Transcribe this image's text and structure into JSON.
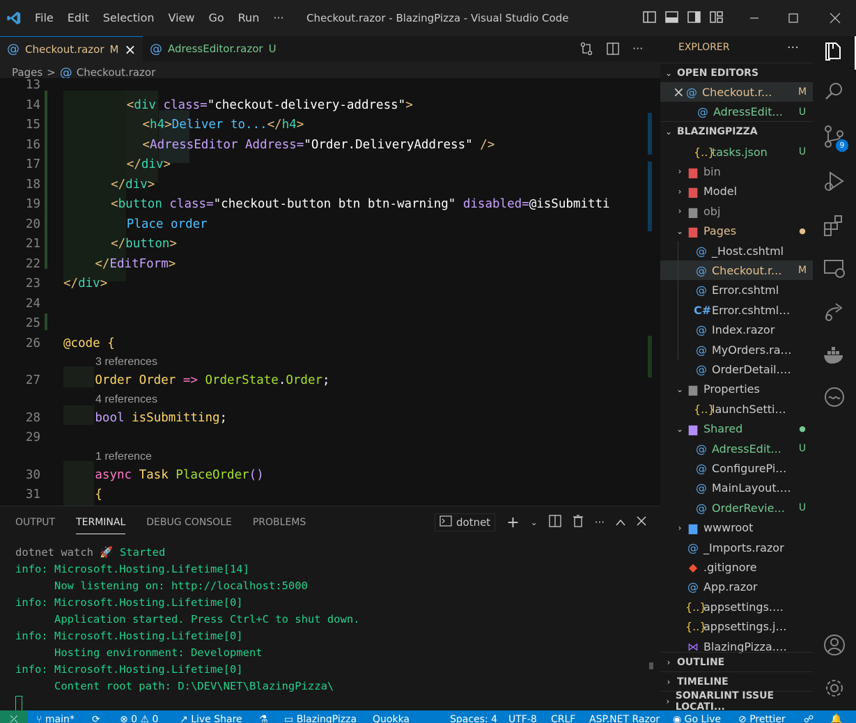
{
  "window": {
    "title": "Checkout.razor - BlazingPizza - Visual Studio Code"
  },
  "menu": [
    "File",
    "Edit",
    "Selection",
    "View",
    "Go",
    "Run",
    "···"
  ],
  "tabs": [
    {
      "label": "Checkout.razor",
      "status": "M",
      "close": "×"
    },
    {
      "label": "AdressEditor.razor",
      "status": "U"
    }
  ],
  "breadcrumb": {
    "folder": "Pages",
    "sep": ">",
    "file": "Checkout.razor"
  },
  "editor": {
    "lines": [
      {
        "n": "13"
      },
      {
        "n": "14",
        "indent": 4,
        "parts": [
          [
            "t-tag",
            "<"
          ],
          [
            "t-name",
            "div"
          ],
          [
            "t-attr",
            " class"
          ],
          [
            "t-punc",
            "="
          ],
          [
            "t-str",
            "\"checkout-delivery-address\""
          ],
          [
            "t-tag",
            ">"
          ]
        ]
      },
      {
        "n": "15",
        "indent": 5,
        "parts": [
          [
            "t-tag",
            "<"
          ],
          [
            "t-name",
            "h4"
          ],
          [
            "t-tag",
            ">"
          ],
          [
            "t-txt",
            "Deliver to..."
          ],
          [
            "t-tag",
            "</"
          ],
          [
            "t-name",
            "h4"
          ],
          [
            "t-tag",
            ">"
          ]
        ]
      },
      {
        "n": "16",
        "indent": 5,
        "parts": [
          [
            "t-tag",
            "<"
          ],
          [
            "t-attr",
            "AdressEditor"
          ],
          [
            "t-attr",
            " Address"
          ],
          [
            "t-punc",
            "="
          ],
          [
            "t-str",
            "\"Order.DeliveryAddress\""
          ],
          [
            "t-tag",
            " />"
          ]
        ]
      },
      {
        "n": "17",
        "indent": 4,
        "parts": [
          [
            "t-tag",
            "</"
          ],
          [
            "t-name",
            "div"
          ],
          [
            "t-tag",
            ">"
          ]
        ]
      },
      {
        "n": "18",
        "indent": 3,
        "parts": [
          [
            "t-tag",
            "</"
          ],
          [
            "t-name",
            "div"
          ],
          [
            "t-tag",
            ">"
          ]
        ]
      },
      {
        "n": "19",
        "indent": 3,
        "parts": [
          [
            "t-tag",
            "<"
          ],
          [
            "t-name",
            "button"
          ],
          [
            "t-attr",
            " class"
          ],
          [
            "t-punc",
            "="
          ],
          [
            "t-str",
            "\"checkout-button btn btn-warning\""
          ],
          [
            "t-attr",
            " disabled"
          ],
          [
            "t-punc",
            "="
          ],
          [
            "t-str",
            "@isSubmitti"
          ]
        ]
      },
      {
        "n": "20",
        "indent": 4,
        "parts": [
          [
            "t-txt",
            "Place order"
          ]
        ]
      },
      {
        "n": "21",
        "indent": 3,
        "parts": [
          [
            "t-tag",
            "</"
          ],
          [
            "t-name",
            "button"
          ],
          [
            "t-tag",
            ">"
          ]
        ]
      },
      {
        "n": "22",
        "indent": 2,
        "parts": [
          [
            "t-tag",
            "</"
          ],
          [
            "t-attr",
            "EditForm"
          ],
          [
            "t-tag",
            ">"
          ]
        ]
      },
      {
        "n": "23",
        "indent": 0,
        "parts": [
          [
            "t-tag",
            "</"
          ],
          [
            "t-name",
            "div"
          ],
          [
            "t-tag",
            ">"
          ]
        ]
      },
      {
        "n": "24"
      },
      {
        "n": "25"
      },
      {
        "n": "26",
        "indent": 0,
        "parts": [
          [
            "t-code",
            "@code"
          ],
          [
            "t-type",
            " {"
          ]
        ]
      },
      {
        "ref": "3 references"
      },
      {
        "n": "27",
        "indent": 2,
        "parts": [
          [
            "t-type",
            "Order"
          ],
          [
            "t-type",
            " Order"
          ],
          [
            "t-kw",
            " =>"
          ],
          [
            "t-fn",
            " OrderState"
          ],
          [
            "t-var",
            "."
          ],
          [
            "t-fn",
            "Order"
          ],
          [
            "t-var",
            ";"
          ]
        ]
      },
      {
        "ref": "4 references"
      },
      {
        "n": "28",
        "indent": 2,
        "parts": [
          [
            "t-attr",
            "bool"
          ],
          [
            "t-type",
            " isSubmitting"
          ],
          [
            "t-var",
            ";"
          ]
        ]
      },
      {
        "n": "29"
      },
      {
        "ref": "1 reference"
      },
      {
        "n": "30",
        "indent": 2,
        "parts": [
          [
            "t-kw",
            "async"
          ],
          [
            "t-type",
            " Task"
          ],
          [
            "t-fn",
            " PlaceOrder"
          ],
          [
            "t-punc",
            "()"
          ]
        ]
      },
      {
        "n": "31",
        "indent": 2,
        "parts": [
          [
            "t-type",
            "{"
          ]
        ]
      }
    ]
  },
  "panel": {
    "tabs": [
      "OUTPUT",
      "TERMINAL",
      "DEBUG CONSOLE",
      "PROBLEMS"
    ],
    "active_tab": "TERMINAL",
    "shell": "dotnet",
    "terminal": [
      {
        "a": "dotnet watch ",
        "b": "🚀 Started"
      },
      {
        "a": "info: Microsoft.Hosting.Lifetime[14]"
      },
      {
        "a": "      Now listening on: http://localhost:5000"
      },
      {
        "a": "info: Microsoft.Hosting.Lifetime[0]"
      },
      {
        "a": "      Application started. Press Ctrl+C to shut down."
      },
      {
        "a": "info: Microsoft.Hosting.Lifetime[0]"
      },
      {
        "a": "      Hosting environment: Development"
      },
      {
        "a": "info: Microsoft.Hosting.Lifetime[0]"
      },
      {
        "a": "      Content root path: D:\\DEV\\NET\\BlazingPizza\\"
      }
    ]
  },
  "explorer": {
    "title": "EXPLORER",
    "more": "···",
    "open_editors_label": "OPEN EDITORS",
    "project_label": "BLAZINGPIZZA",
    "outline_label": "OUTLINE",
    "timeline_label": "TIMELINE",
    "sonarlint_label": "SONARLINT ISSUE LOCATI...",
    "open_editors": [
      {
        "label": "Checkout.r...",
        "badge": "M"
      },
      {
        "label": "AdressEdit...",
        "badge": "U"
      }
    ],
    "tree": [
      {
        "label": "tasks.json",
        "badge": "U",
        "icon": "{..}",
        "cls": "c-new",
        "depth": 2
      },
      {
        "label": "bin",
        "icon": "▆",
        "cls": "c-dim",
        "depth": 1,
        "chev": "›"
      },
      {
        "label": "Model",
        "icon": "▆",
        "cls": "c-def",
        "depth": 1,
        "chev": "›"
      },
      {
        "label": "obj",
        "icon": "▆",
        "cls": "c-dim",
        "depth": 1,
        "chev": "›"
      },
      {
        "label": "Pages",
        "icon": "▆",
        "cls": "c-mod",
        "depth": 1,
        "chev": "⌄",
        "dot": "●"
      },
      {
        "label": "_Host.cshtml",
        "icon": "@",
        "cls": "c-def",
        "depth": 2
      },
      {
        "label": "Checkout.r...",
        "badge": "M",
        "icon": "@",
        "cls": "c-mod",
        "depth": 2,
        "sel": true
      },
      {
        "label": "Error.cshtml",
        "icon": "@",
        "cls": "c-def",
        "depth": 2
      },
      {
        "label": "Error.cshtml.cs",
        "icon": "C#",
        "cls": "c-def",
        "depth": 2
      },
      {
        "label": "Index.razor",
        "icon": "@",
        "cls": "c-def",
        "depth": 2
      },
      {
        "label": "MyOrders.razor",
        "icon": "@",
        "cls": "c-def",
        "depth": 2
      },
      {
        "label": "OrderDetail.razor",
        "icon": "@",
        "cls": "c-def",
        "depth": 2
      },
      {
        "label": "Properties",
        "icon": "▆",
        "cls": "c-def",
        "depth": 1,
        "chev": "⌄"
      },
      {
        "label": "launchSettings.js...",
        "icon": "{..}",
        "cls": "c-def",
        "depth": 2
      },
      {
        "label": "Shared",
        "icon": "▆",
        "cls": "c-new",
        "depth": 1,
        "chev": "⌄",
        "dot": "●"
      },
      {
        "label": "AdressEdit...",
        "badge": "U",
        "icon": "@",
        "cls": "c-new",
        "depth": 2
      },
      {
        "label": "ConfigurePizzaD...",
        "icon": "@",
        "cls": "c-def",
        "depth": 2
      },
      {
        "label": "MainLayout.razor",
        "icon": "@",
        "cls": "c-def",
        "depth": 2
      },
      {
        "label": "OrderRevie...",
        "badge": "U",
        "icon": "@",
        "cls": "c-new",
        "depth": 2
      },
      {
        "label": "wwwroot",
        "icon": "▆",
        "cls": "c-def",
        "depth": 1,
        "chev": "›"
      },
      {
        "label": "_Imports.razor",
        "icon": "@",
        "cls": "c-def",
        "depth": 1
      },
      {
        "label": ".gitignore",
        "icon": "◆",
        "cls": "c-def",
        "depth": 1
      },
      {
        "label": "App.razor",
        "icon": "@",
        "cls": "c-def",
        "depth": 1
      },
      {
        "label": "appsettings.Devel...",
        "icon": "{..}",
        "cls": "c-def",
        "depth": 1
      },
      {
        "label": "appsettings.json",
        "icon": "{..}",
        "cls": "c-def",
        "depth": 1
      },
      {
        "label": "BlazingPizza.csproj",
        "icon": "⋈",
        "cls": "c-def",
        "depth": 1
      }
    ]
  },
  "activity": {
    "scm_badge": "9"
  },
  "status": {
    "branch": "main*",
    "errors": "⊗ 0 ⚠ 0",
    "liveshare": "Live Share",
    "project": "BlazingPizza",
    "quokka": "Quokka",
    "spaces": "Spaces: 4",
    "encoding": "UTF-8",
    "eol": "CRLF",
    "language": "ASP.NET Razor",
    "golive": "Go Live",
    "prettier": "Prettier"
  }
}
